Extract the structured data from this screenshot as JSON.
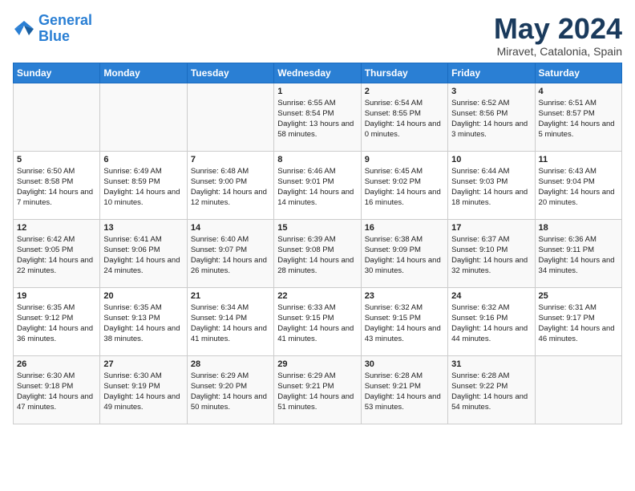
{
  "logo": {
    "line1": "General",
    "line2": "Blue"
  },
  "title": "May 2024",
  "location": "Miravet, Catalonia, Spain",
  "days_of_week": [
    "Sunday",
    "Monday",
    "Tuesday",
    "Wednesday",
    "Thursday",
    "Friday",
    "Saturday"
  ],
  "weeks": [
    [
      {
        "day": "",
        "content": ""
      },
      {
        "day": "",
        "content": ""
      },
      {
        "day": "",
        "content": ""
      },
      {
        "day": "1",
        "content": "Sunrise: 6:55 AM\nSunset: 8:54 PM\nDaylight: 13 hours and 58 minutes."
      },
      {
        "day": "2",
        "content": "Sunrise: 6:54 AM\nSunset: 8:55 PM\nDaylight: 14 hours and 0 minutes."
      },
      {
        "day": "3",
        "content": "Sunrise: 6:52 AM\nSunset: 8:56 PM\nDaylight: 14 hours and 3 minutes."
      },
      {
        "day": "4",
        "content": "Sunrise: 6:51 AM\nSunset: 8:57 PM\nDaylight: 14 hours and 5 minutes."
      }
    ],
    [
      {
        "day": "5",
        "content": "Sunrise: 6:50 AM\nSunset: 8:58 PM\nDaylight: 14 hours and 7 minutes."
      },
      {
        "day": "6",
        "content": "Sunrise: 6:49 AM\nSunset: 8:59 PM\nDaylight: 14 hours and 10 minutes."
      },
      {
        "day": "7",
        "content": "Sunrise: 6:48 AM\nSunset: 9:00 PM\nDaylight: 14 hours and 12 minutes."
      },
      {
        "day": "8",
        "content": "Sunrise: 6:46 AM\nSunset: 9:01 PM\nDaylight: 14 hours and 14 minutes."
      },
      {
        "day": "9",
        "content": "Sunrise: 6:45 AM\nSunset: 9:02 PM\nDaylight: 14 hours and 16 minutes."
      },
      {
        "day": "10",
        "content": "Sunrise: 6:44 AM\nSunset: 9:03 PM\nDaylight: 14 hours and 18 minutes."
      },
      {
        "day": "11",
        "content": "Sunrise: 6:43 AM\nSunset: 9:04 PM\nDaylight: 14 hours and 20 minutes."
      }
    ],
    [
      {
        "day": "12",
        "content": "Sunrise: 6:42 AM\nSunset: 9:05 PM\nDaylight: 14 hours and 22 minutes."
      },
      {
        "day": "13",
        "content": "Sunrise: 6:41 AM\nSunset: 9:06 PM\nDaylight: 14 hours and 24 minutes."
      },
      {
        "day": "14",
        "content": "Sunrise: 6:40 AM\nSunset: 9:07 PM\nDaylight: 14 hours and 26 minutes."
      },
      {
        "day": "15",
        "content": "Sunrise: 6:39 AM\nSunset: 9:08 PM\nDaylight: 14 hours and 28 minutes."
      },
      {
        "day": "16",
        "content": "Sunrise: 6:38 AM\nSunset: 9:09 PM\nDaylight: 14 hours and 30 minutes."
      },
      {
        "day": "17",
        "content": "Sunrise: 6:37 AM\nSunset: 9:10 PM\nDaylight: 14 hours and 32 minutes."
      },
      {
        "day": "18",
        "content": "Sunrise: 6:36 AM\nSunset: 9:11 PM\nDaylight: 14 hours and 34 minutes."
      }
    ],
    [
      {
        "day": "19",
        "content": "Sunrise: 6:35 AM\nSunset: 9:12 PM\nDaylight: 14 hours and 36 minutes."
      },
      {
        "day": "20",
        "content": "Sunrise: 6:35 AM\nSunset: 9:13 PM\nDaylight: 14 hours and 38 minutes."
      },
      {
        "day": "21",
        "content": "Sunrise: 6:34 AM\nSunset: 9:14 PM\nDaylight: 14 hours and 41 minutes."
      },
      {
        "day": "22",
        "content": "Sunrise: 6:33 AM\nSunset: 9:15 PM\nDaylight: 14 hours and 41 minutes."
      },
      {
        "day": "23",
        "content": "Sunrise: 6:32 AM\nSunset: 9:15 PM\nDaylight: 14 hours and 43 minutes."
      },
      {
        "day": "24",
        "content": "Sunrise: 6:32 AM\nSunset: 9:16 PM\nDaylight: 14 hours and 44 minutes."
      },
      {
        "day": "25",
        "content": "Sunrise: 6:31 AM\nSunset: 9:17 PM\nDaylight: 14 hours and 46 minutes."
      }
    ],
    [
      {
        "day": "26",
        "content": "Sunrise: 6:30 AM\nSunset: 9:18 PM\nDaylight: 14 hours and 47 minutes."
      },
      {
        "day": "27",
        "content": "Sunrise: 6:30 AM\nSunset: 9:19 PM\nDaylight: 14 hours and 49 minutes."
      },
      {
        "day": "28",
        "content": "Sunrise: 6:29 AM\nSunset: 9:20 PM\nDaylight: 14 hours and 50 minutes."
      },
      {
        "day": "29",
        "content": "Sunrise: 6:29 AM\nSunset: 9:21 PM\nDaylight: 14 hours and 51 minutes."
      },
      {
        "day": "30",
        "content": "Sunrise: 6:28 AM\nSunset: 9:21 PM\nDaylight: 14 hours and 53 minutes."
      },
      {
        "day": "31",
        "content": "Sunrise: 6:28 AM\nSunset: 9:22 PM\nDaylight: 14 hours and 54 minutes."
      },
      {
        "day": "",
        "content": ""
      }
    ]
  ]
}
